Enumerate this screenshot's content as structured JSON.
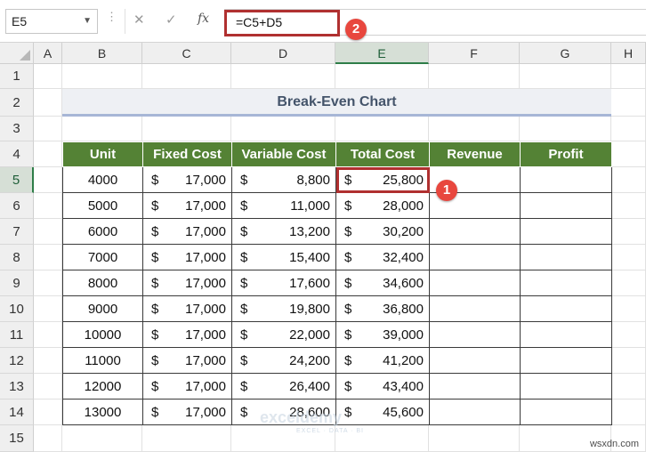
{
  "formula_bar": {
    "name_box": "E5",
    "cancel_icon": "✕",
    "enter_icon": "✓",
    "fx_label": "fx",
    "formula": "=C5+D5"
  },
  "callouts": {
    "one": "1",
    "two": "2"
  },
  "columns": [
    "A",
    "B",
    "C",
    "D",
    "E",
    "F",
    "G",
    "H"
  ],
  "selected_column": "E",
  "rows": [
    "1",
    "2",
    "3",
    "4",
    "5",
    "6",
    "7",
    "8",
    "9",
    "10",
    "11",
    "12",
    "13",
    "14",
    "15"
  ],
  "selected_row": "5",
  "sheet": {
    "title": "Break-Even Chart",
    "headers": [
      "Unit",
      "Fixed Cost",
      "Variable Cost",
      "Total Cost",
      "Revenue",
      "Profit"
    ],
    "currency": "$",
    "data": [
      {
        "unit": "4000",
        "fixed": "17,000",
        "variable": "8,800",
        "total": "25,800"
      },
      {
        "unit": "5000",
        "fixed": "17,000",
        "variable": "11,000",
        "total": "28,000"
      },
      {
        "unit": "6000",
        "fixed": "17,000",
        "variable": "13,200",
        "total": "30,200"
      },
      {
        "unit": "7000",
        "fixed": "17,000",
        "variable": "15,400",
        "total": "32,400"
      },
      {
        "unit": "8000",
        "fixed": "17,000",
        "variable": "17,600",
        "total": "34,600"
      },
      {
        "unit": "9000",
        "fixed": "17,000",
        "variable": "19,800",
        "total": "36,800"
      },
      {
        "unit": "10000",
        "fixed": "17,000",
        "variable": "22,000",
        "total": "39,000"
      },
      {
        "unit": "11000",
        "fixed": "17,000",
        "variable": "24,200",
        "total": "41,200"
      },
      {
        "unit": "12000",
        "fixed": "17,000",
        "variable": "26,400",
        "total": "43,400"
      },
      {
        "unit": "13000",
        "fixed": "17,000",
        "variable": "28,600",
        "total": "45,600"
      }
    ]
  },
  "watermark": {
    "name": "exceldemy",
    "tagline": "EXCEL · DATA · BI"
  },
  "site": "wsxdn.com",
  "colors": {
    "header_green": "#548235",
    "selection_red": "#b03030",
    "callout_red": "#e8473e"
  }
}
